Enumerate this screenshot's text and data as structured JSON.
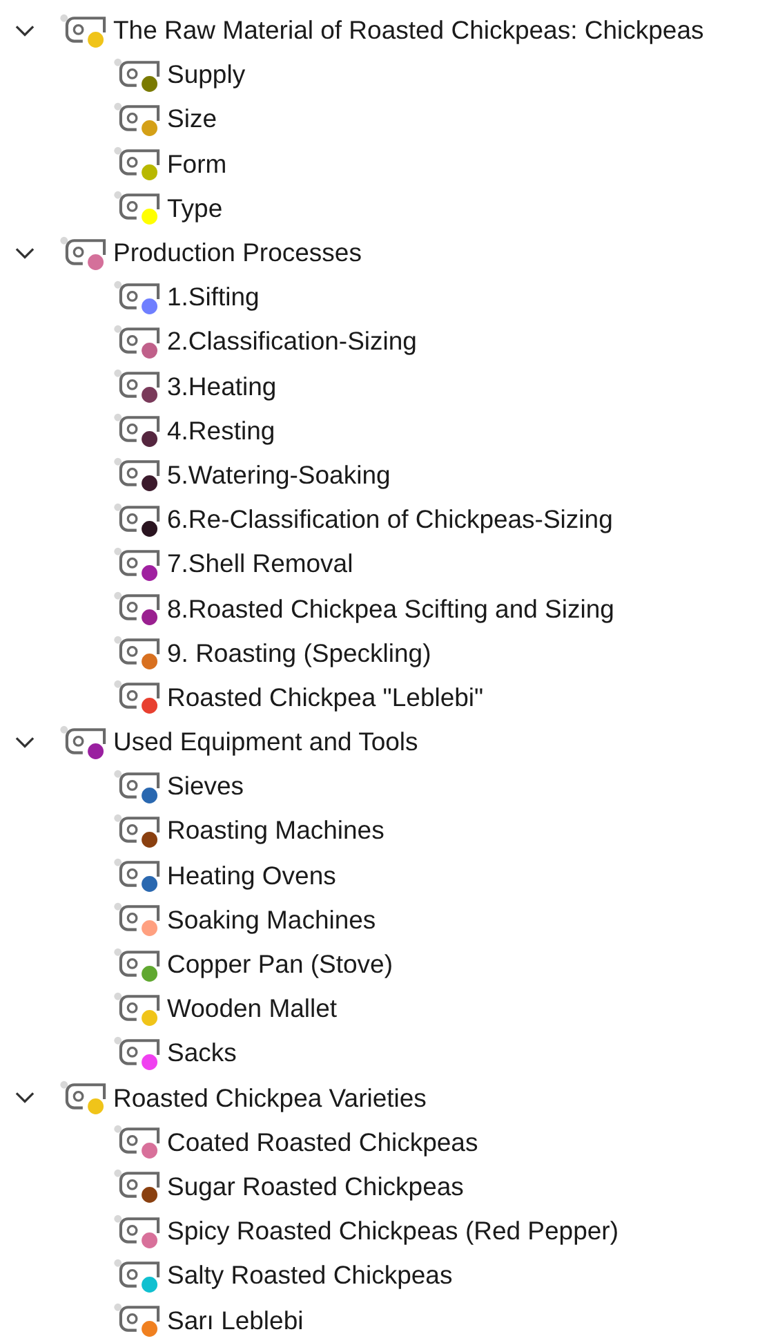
{
  "tree": [
    {
      "label": "The Raw Material of Roasted Chickpeas: Chickpeas",
      "color": "#f0c419",
      "expanded": true,
      "children": [
        {
          "label": "Supply",
          "color": "#7a7a00"
        },
        {
          "label": "Size",
          "color": "#d4a017"
        },
        {
          "label": "Form",
          "color": "#b8b800"
        },
        {
          "label": "Type",
          "color": "#ffff00"
        }
      ]
    },
    {
      "label": "Production Processes",
      "color": "#d4709a",
      "expanded": true,
      "children": [
        {
          "label": "1.Sifting",
          "color": "#6f7fff"
        },
        {
          "label": "2.Classification-Sizing",
          "color": "#c0608a"
        },
        {
          "label": "3.Heating",
          "color": "#7a3a5a"
        },
        {
          "label": "4.Resting",
          "color": "#55263f"
        },
        {
          "label": "5.Watering-Soaking",
          "color": "#3c1a2c"
        },
        {
          "label": "6.Re-Classification of Chickpeas-Sizing",
          "color": "#2a1420"
        },
        {
          "label": "7.Shell Removal",
          "color": "#a020a0"
        },
        {
          "label": "8.Roasted Chickpea Scifting and Sizing",
          "color": "#9a2090"
        },
        {
          "label": "9. Roasting (Speckling)",
          "color": "#d87020"
        },
        {
          "label": "Roasted Chickpea \"Leblebi\"",
          "color": "#e84030"
        }
      ]
    },
    {
      "label": "Used Equipment and Tools",
      "color": "#9a20a0",
      "expanded": true,
      "children": [
        {
          "label": "Sieves",
          "color": "#2a68b0"
        },
        {
          "label": "Roasting Machines",
          "color": "#8a4010"
        },
        {
          "label": "Heating Ovens",
          "color": "#2a68b0"
        },
        {
          "label": "Soaking Machines",
          "color": "#ffa080"
        },
        {
          "label": "Copper Pan (Stove)",
          "color": "#60a830"
        },
        {
          "label": "Wooden Mallet",
          "color": "#f0c419"
        },
        {
          "label": "Sacks",
          "color": "#f040f0"
        }
      ]
    },
    {
      "label": "Roasted Chickpea Varieties",
      "color": "#f0c419",
      "expanded": true,
      "children": [
        {
          "label": "Coated Roasted Chickpeas",
          "color": "#d8709a"
        },
        {
          "label": "Sugar Roasted Chickpeas",
          "color": "#8a4010"
        },
        {
          "label": "Spicy Roasted Chickpeas (Red Pepper)",
          "color": "#d8709a"
        },
        {
          "label": "Salty Roasted Chickpeas",
          "color": "#10c0d0"
        },
        {
          "label": "Sarı Leblebi",
          "color": "#f08020"
        }
      ]
    }
  ]
}
